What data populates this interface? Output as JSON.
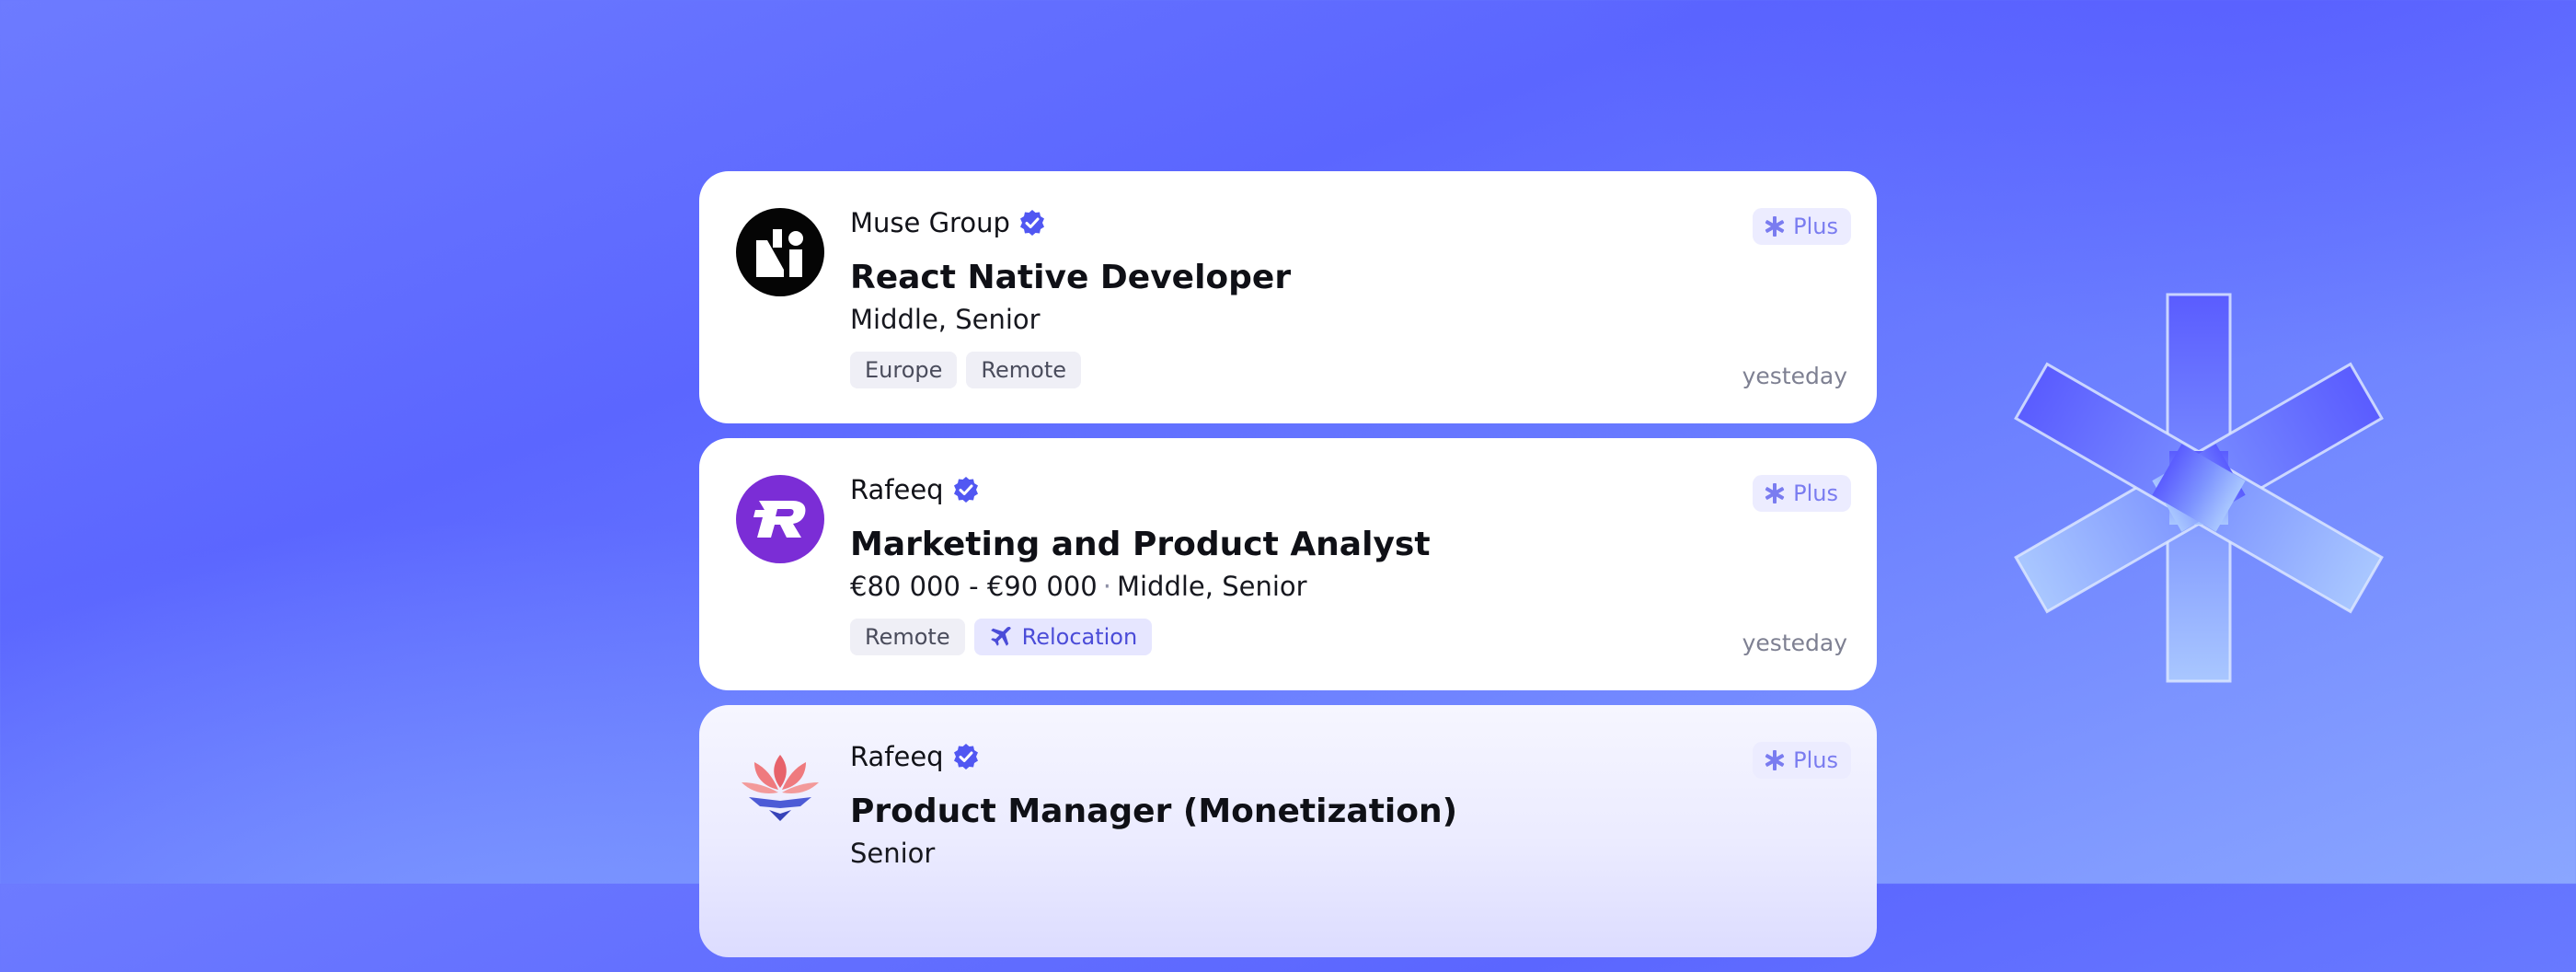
{
  "colors": {
    "background": "#5b66ff",
    "accent": "#5157f2",
    "plus_badge_text": "#7a7cf0",
    "card": "#ffffff"
  },
  "jobs": [
    {
      "company": "Muse Group",
      "verified": true,
      "logo_icon": "muse-group-logo",
      "title": "React Native Developer",
      "salary": "",
      "levels": "Middle, Senior",
      "tags": [
        {
          "label": "Europe",
          "icon": ""
        },
        {
          "label": "Remote",
          "icon": ""
        }
      ],
      "badge": "Plus",
      "date": "yesteday"
    },
    {
      "company": "Rafeeq",
      "verified": true,
      "logo_icon": "rafeeq-logo",
      "title": "Marketing and Product Analyst",
      "salary": "€80 000 - €90 000",
      "levels": "Middle, Senior",
      "tags": [
        {
          "label": "Remote",
          "icon": ""
        },
        {
          "label": "Relocation",
          "icon": "plane-icon"
        }
      ],
      "badge": "Plus",
      "date": "yesteday"
    },
    {
      "company": "Rafeeq",
      "verified": true,
      "logo_icon": "lotus-logo",
      "title": "Product Manager (Monetization)",
      "salary": "",
      "levels": "Senior",
      "tags": [],
      "badge": "Plus",
      "date": ""
    }
  ]
}
